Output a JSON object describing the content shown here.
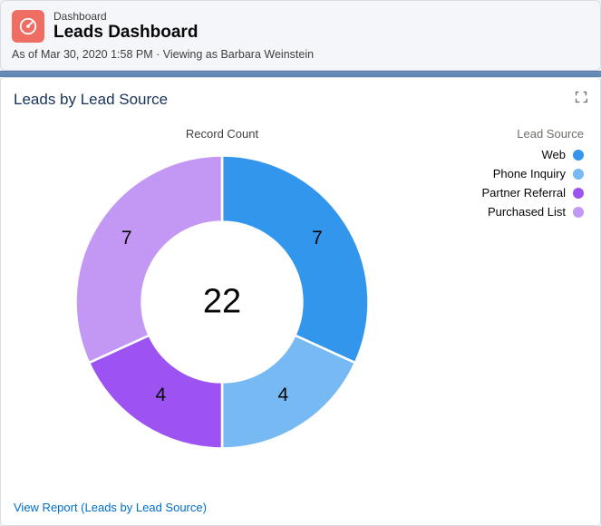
{
  "header": {
    "page_type": "Dashboard",
    "title": "Leads Dashboard",
    "meta": "As of Mar 30, 2020 1:58 PM · Viewing as Barbara Weinstein"
  },
  "card": {
    "title": "Leads by Lead Source",
    "chart_caption": "Record Count",
    "center_value": "22",
    "legend_title": "Lead Source",
    "footer_link": "View Report (Leads by Lead Source)"
  },
  "legend": [
    {
      "label": "Web",
      "color": "#3296ed"
    },
    {
      "label": "Phone Inquiry",
      "color": "#77b9f2"
    },
    {
      "label": "Partner Referral",
      "color": "#9d53f2"
    },
    {
      "label": "Purchased List",
      "color": "#c398f5"
    }
  ],
  "colors": {
    "web": "#3296ed",
    "phone_inquiry": "#77b9f2",
    "partner_referral": "#9d53f2",
    "purchased_list": "#c398f5"
  },
  "chart_data": {
    "type": "pie",
    "title": "Leads by Lead Source",
    "caption": "Record Count",
    "total": 22,
    "series": [
      {
        "name": "Web",
        "value": 7,
        "color": "#3296ed"
      },
      {
        "name": "Phone Inquiry",
        "value": 4,
        "color": "#77b9f2"
      },
      {
        "name": "Partner Referral",
        "value": 4,
        "color": "#9d53f2"
      },
      {
        "name": "Purchased List",
        "value": 7,
        "color": "#c398f5"
      }
    ]
  }
}
